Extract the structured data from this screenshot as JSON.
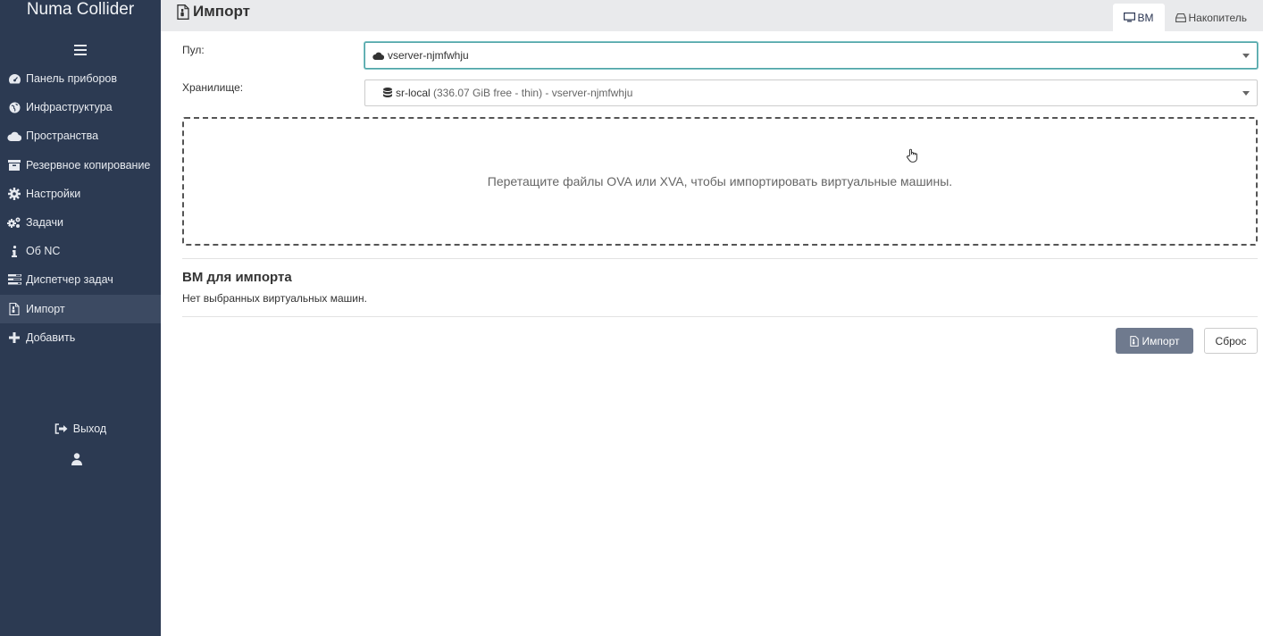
{
  "app": {
    "brand": "Numa Collider"
  },
  "sidebar": {
    "items": [
      {
        "label": "Панель приборов",
        "icon": "dashboard-icon"
      },
      {
        "label": "Инфраструктура",
        "icon": "globe-icon"
      },
      {
        "label": "Пространства",
        "icon": "cloud-icon"
      },
      {
        "label": "Резервное копирование",
        "icon": "archive-icon"
      },
      {
        "label": "Настройки",
        "icon": "gear-icon"
      },
      {
        "label": "Задачи",
        "icon": "cogs-icon"
      },
      {
        "label": "Об NC",
        "icon": "info-icon"
      },
      {
        "label": "Диспетчер задач",
        "icon": "tasks-icon"
      },
      {
        "label": "Импорт",
        "icon": "file-import-icon",
        "active": true
      },
      {
        "label": "Добавить",
        "icon": "plus-icon"
      }
    ],
    "logout_label": "Выход"
  },
  "header": {
    "title": "Импорт",
    "tabs": [
      {
        "label": "ВМ",
        "icon": "monitor-icon",
        "active": true
      },
      {
        "label": "Накопитель",
        "icon": "drive-icon"
      }
    ]
  },
  "form": {
    "pool_label": "Пул:",
    "pool_value": "vserver-njmfwhju",
    "storage_label": "Хранилище:",
    "storage_name": "sr-local",
    "storage_detail": "(336.07 GiB free - thin) - vserver-njmfwhju"
  },
  "dropzone": {
    "text": "Перетащите файлы OVA или XVA, чтобы импортировать виртуальные машины."
  },
  "vms": {
    "title": "ВМ для импорта",
    "empty_text": "Нет выбранных виртуальных машин."
  },
  "actions": {
    "import_label": "Импорт",
    "reset_label": "Сброс"
  },
  "colors": {
    "sidebar_bg": "#2c3a52",
    "accent": "#4fa3a6",
    "button_primary": "#6f7a8e"
  }
}
